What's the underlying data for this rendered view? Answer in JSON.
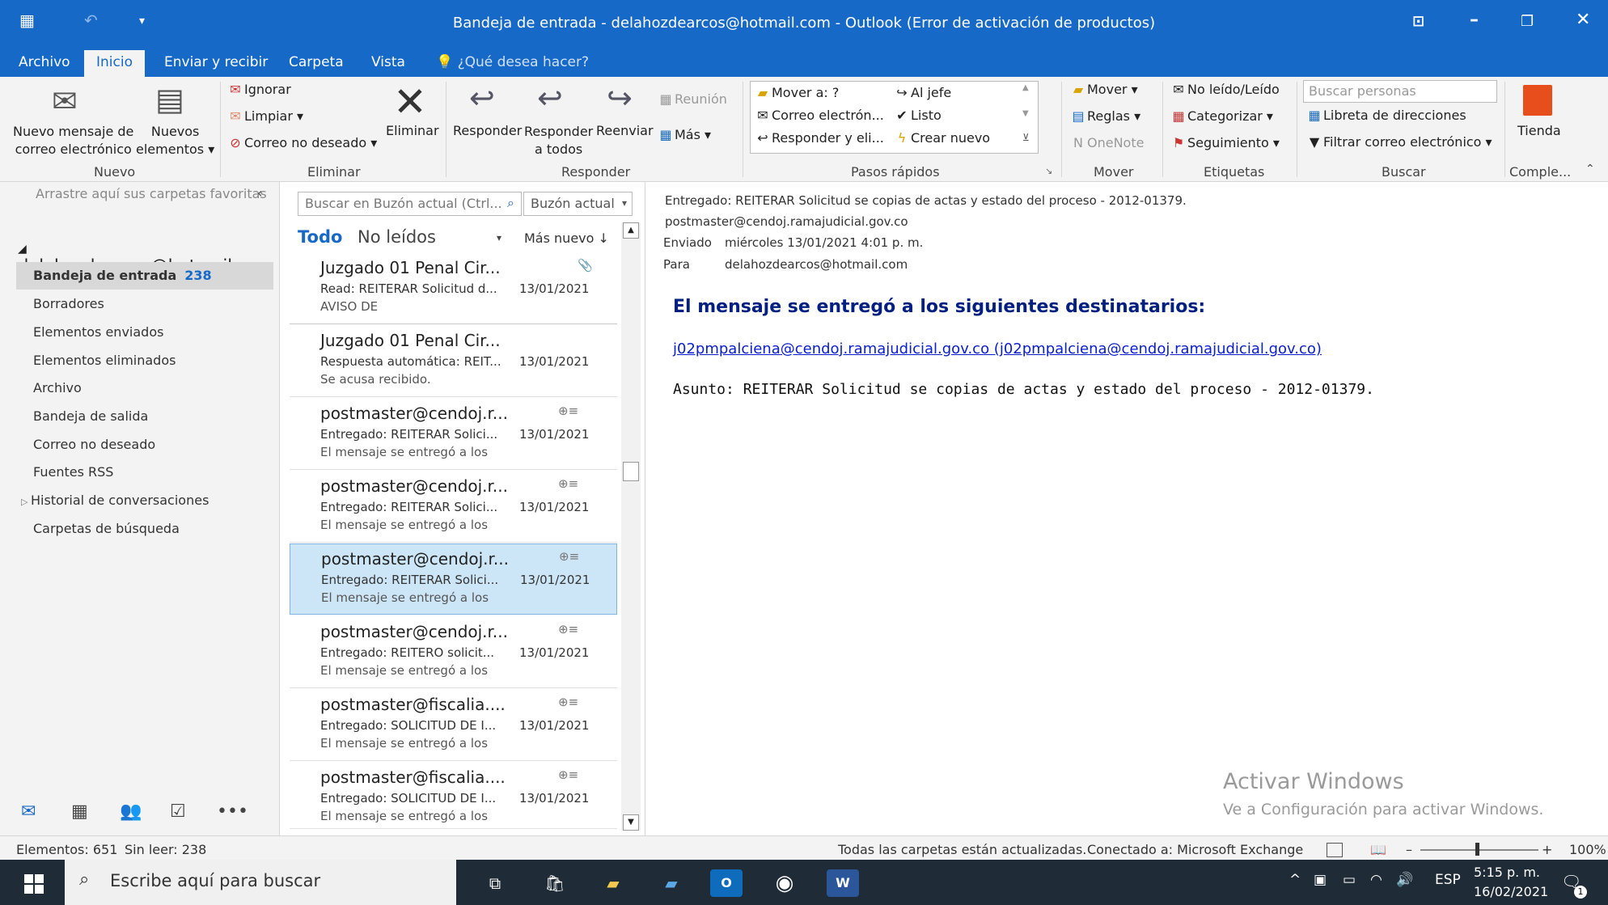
{
  "titlebar": {
    "title": "Bandeja de entrada - delahozdearcos@hotmail.com - Outlook (Error de activación de productos)",
    "qat_icons": [
      "outlook-app-icon",
      "undo-icon",
      "customize-qat-icon"
    ],
    "window_buttons": [
      "ribbon-display-icon",
      "minimize-icon",
      "restore-icon",
      "close-icon"
    ]
  },
  "tabs": [
    {
      "label": "Archivo"
    },
    {
      "label": "Inicio"
    },
    {
      "label": "Enviar y recibir"
    },
    {
      "label": "Carpeta"
    },
    {
      "label": "Vista"
    }
  ],
  "tell_me": "¿Qué desea hacer?",
  "ribbon": {
    "groups": {
      "nuevo": "Nuevo",
      "eliminar": "Eliminar",
      "responder": "Responder",
      "pasos": "Pasos rápidos",
      "mover": "Mover",
      "etiquetas": "Etiquetas",
      "buscar": "Buscar",
      "complementos": "Comple..."
    },
    "new_mail": [
      "Nuevo mensaje de",
      "correo electrónico"
    ],
    "new_items": [
      "Nuevos",
      "elementos"
    ],
    "ignore": "Ignorar",
    "cleanup": "Limpiar",
    "junk": "Correo no deseado",
    "delete": "Eliminar",
    "reply": "Responder",
    "reply_all": [
      "Responder",
      "a todos"
    ],
    "forward": "Reenviar",
    "meeting": "Reunión",
    "more": "Más",
    "quick_steps": [
      "Mover a: ?",
      "Correo electrón...",
      "Responder y eli...",
      "Al jefe",
      "Listo",
      "Crear nuevo"
    ],
    "move": "Mover",
    "rules": "Reglas",
    "onenote": "OneNote",
    "unread_read": "No leído/Leído",
    "categorize": "Categorizar",
    "followup": "Seguimiento",
    "search_people_placeholder": "Buscar personas",
    "address_book": "Libreta de direcciones",
    "filter_email": "Filtrar correo electrónico",
    "store": "Tienda"
  },
  "nav": {
    "favorites_hint": "Arrastre aquí sus carpetas favoritas",
    "account": "delahozdearcos@hotmail.com",
    "inbox": "Bandeja de entrada",
    "inbox_count": "238",
    "folders": [
      "Borradores",
      "Elementos enviados",
      "Elementos eliminados",
      "Archivo",
      "Bandeja de salida",
      "Correo no deseado",
      "Fuentes RSS",
      "Historial de conversaciones",
      "Carpetas de búsqueda"
    ],
    "footer_icons": [
      "mail-icon",
      "calendar-icon",
      "people-icon",
      "tasks-icon",
      "more-icon"
    ]
  },
  "list": {
    "search_placeholder": "Buscar en Buzón actual (Ctrl...",
    "scope": "Buzón actual",
    "filter_all": "Todo",
    "filter_unread": "No leídos",
    "sort": "Más nuevo",
    "messages": [
      {
        "from": "Juzgado 01 Penal Cir...",
        "subject": "Read: REITERAR Solicitud d...",
        "date": "13/01/2021",
        "preview": "AVISO DE",
        "icon": "attachment-icon"
      },
      {
        "from": "Juzgado 01 Penal Cir...",
        "subject": "Respuesta automática: REIT...",
        "date": "13/01/2021",
        "preview": "Se acusa recibido.",
        "icon": ""
      },
      {
        "from": "postmaster@cendoj.r...",
        "subject": "Entregado: REITERAR Solici...",
        "date": "13/01/2021",
        "preview": "El mensaje se entregó a los",
        "icon": "delivery-receipt-icon"
      },
      {
        "from": "postmaster@cendoj.r...",
        "subject": "Entregado: REITERAR Solici...",
        "date": "13/01/2021",
        "preview": "El mensaje se entregó a los",
        "icon": "delivery-receipt-icon"
      },
      {
        "from": "postmaster@cendoj.r...",
        "subject": "Entregado: REITERAR Solici...",
        "date": "13/01/2021",
        "preview": "El mensaje se entregó a los",
        "icon": "delivery-receipt-icon"
      },
      {
        "from": "postmaster@cendoj.r...",
        "subject": "Entregado: REITERO solicit...",
        "date": "13/01/2021",
        "preview": "El mensaje se entregó a los",
        "icon": "delivery-receipt-icon"
      },
      {
        "from": "postmaster@fiscalia....",
        "subject": "Entregado: SOLICITUD DE I...",
        "date": "13/01/2021",
        "preview": "El mensaje se entregó a los",
        "icon": "delivery-receipt-icon"
      },
      {
        "from": "postmaster@fiscalia....",
        "subject": "Entregado: SOLICITUD DE I...",
        "date": "13/01/2021",
        "preview": "El mensaje se entregó a los",
        "icon": "delivery-receipt-icon"
      }
    ]
  },
  "reading": {
    "subject": "Entregado: REITERAR Solicitud se copias de actas y estado del proceso - 2012-01379.",
    "from": "postmaster@cendoj.ramajudicial.gov.co",
    "sent_label": "Enviado",
    "sent_value": "miércoles 13/01/2021 4:01 p. m.",
    "to_label": "Para",
    "to_value": "delahozdearcos@hotmail.com",
    "heading": "El mensaje se entregó a los siguientes destinatarios:",
    "recipient_link": "j02pmpalciena@cendoj.ramajudicial.gov.co (j02pmpalciena@cendoj.ramajudicial.gov.co)",
    "asunto": "Asunto: REITERAR Solicitud se copias de actas y estado del proceso - 2012-01379."
  },
  "watermark": {
    "line1": "Activar Windows",
    "line2": "Ve a Configuración para activar Windows."
  },
  "status": {
    "items": "Elementos: 651",
    "unread": "Sin leer: 238",
    "folders_updated": "Todas las carpetas están actualizadas.",
    "connected": "Conectado a: Microsoft Exchange",
    "zoom": "100%"
  },
  "taskbar": {
    "search_placeholder": "Escribe aquí para buscar",
    "lang": "ESP",
    "time": "5:15 p. m.",
    "date": "16/02/2021",
    "notification_count": "1"
  },
  "colors": {
    "accent": "#1769c8",
    "selected_message": "#cde6f7",
    "heading_blue": "#001f80"
  }
}
